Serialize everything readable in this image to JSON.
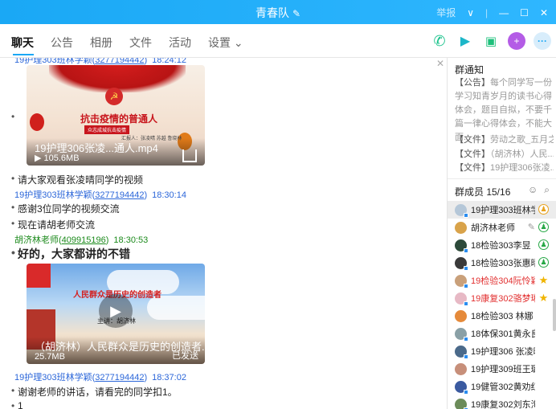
{
  "window": {
    "title": "青春队",
    "right_items": [
      "举报",
      "∨",
      "—",
      "☐",
      "✕"
    ]
  },
  "tabs": [
    {
      "label": "聊天",
      "active": true
    },
    {
      "label": "公告",
      "active": false
    },
    {
      "label": "相册",
      "active": false
    },
    {
      "label": "文件",
      "active": false
    },
    {
      "label": "活动",
      "active": false
    },
    {
      "label": "设置 ⌄",
      "active": false
    }
  ],
  "chat": {
    "top_clipped": {
      "name": "19护理303班林学颖",
      "uid": "3277194442",
      "time": "18:24:12"
    },
    "video1": {
      "headline": "抗击疫情的普通人",
      "subline": "众志成城抗击疫情",
      "names": "汇报人：张凌晴  苏越  鲁晓林",
      "title": "19护理306张凌...通人.mp4",
      "size": "105.6MB"
    },
    "line1": "请大家观看张凌晴同学的视频",
    "msg2": {
      "name": "19护理303班林学颖",
      "uid": "3277194442",
      "time": "18:30:14"
    },
    "line2": "感谢3位同学的视频交流",
    "line3": "现在请胡老师交流",
    "msg3": {
      "name": "胡济林老师",
      "uid": "409915196",
      "time": "18:30:53"
    },
    "line4": "好的，大家都讲的不错",
    "video2": {
      "headline": "人民群众是历史的创造者",
      "sub": "主讲：胡济林",
      "title": "（胡济林）人民群众是历史的创造者.m...",
      "size": "25.7MB",
      "status": "已发送"
    },
    "msg4": {
      "name": "19护理303班林学颖",
      "uid": "3277194442",
      "time": "18:37:02"
    },
    "line5": "谢谢老师的讲话，请看完的同学扣1。",
    "line6": "1"
  },
  "sidebar": {
    "notice_title": "群通知",
    "notice_tag": "【公告】",
    "notice_text": "每个同学写一份学习知青岁月的读书心得体会，题目自拟，不要千篇一律心得体会，不能大面...",
    "files": [
      {
        "tag": "【文件】",
        "name": "劳动之歌_五月之..."
      },
      {
        "tag": "【文件】",
        "name": "（胡济林）人民..."
      },
      {
        "tag": "【文件】",
        "name": "19护理306张凌..."
      }
    ],
    "members_title": "群成员 15/16",
    "members": [
      {
        "name": "19护理303班林学颖",
        "red": false,
        "badge": "admin",
        "selected": true
      },
      {
        "name": "胡济林老师",
        "red": false,
        "badge": "admin",
        "selected": false
      },
      {
        "name": "18检验303李昱",
        "red": false,
        "badge": "admin",
        "selected": false
      },
      {
        "name": "18检验303张惠晴",
        "red": false,
        "badge": "admin",
        "selected": false
      },
      {
        "name": "19检验304阮怜颖",
        "red": true,
        "badge": "star",
        "selected": false
      },
      {
        "name": "19康复302骆梦琳",
        "red": true,
        "badge": "star",
        "selected": false
      },
      {
        "name": "18检验303 林娜",
        "red": false,
        "badge": "",
        "selected": false
      },
      {
        "name": "18体保301黄永良",
        "red": false,
        "badge": "",
        "selected": false
      },
      {
        "name": "19护理306 张凌晴",
        "red": false,
        "badge": "",
        "selected": false
      },
      {
        "name": "19护理309班王璐瑶",
        "red": false,
        "badge": "",
        "selected": false
      },
      {
        "name": "19健管302黄劝红",
        "red": false,
        "badge": "",
        "selected": false
      },
      {
        "name": "19康复302刘东洵",
        "red": false,
        "badge": "",
        "selected": false
      }
    ]
  },
  "colors": {
    "accent": "#1aa8f5",
    "name_blue": "#2b66d9",
    "teacher_green": "#1b8a1b",
    "member_red": "#e23030"
  }
}
